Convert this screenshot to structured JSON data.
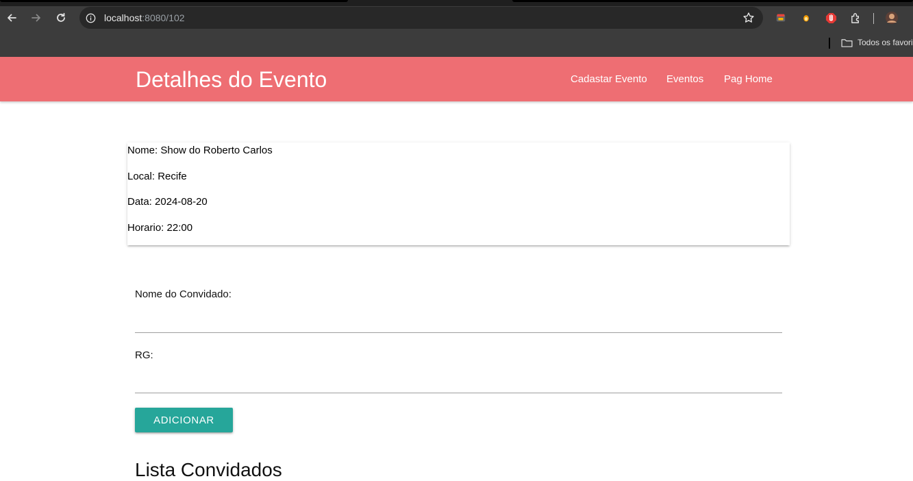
{
  "browser": {
    "url_host": "localhost",
    "url_path": ":8080/102",
    "bookmark_label": "Todos os favorit"
  },
  "app": {
    "brand": "Detalhes do Evento",
    "nav": {
      "register_event": "Cadastar Evento",
      "events": "Eventos",
      "home": "Pag Home"
    },
    "colors": {
      "navbar": "#ee6e73",
      "button": "#26a69a"
    }
  },
  "event": {
    "name": "Nome: Show do Roberto Carlos",
    "place": "Local: Recife",
    "date": "Data: 2024-08-20",
    "time": "Horario: 22:00"
  },
  "form": {
    "guest_name_label": "Nome do Convidado:",
    "guest_name_value": "",
    "rg_label": "RG:",
    "rg_value": "",
    "add_button": "ADICIONAR"
  },
  "guests": {
    "title": "Lista Convidados"
  }
}
